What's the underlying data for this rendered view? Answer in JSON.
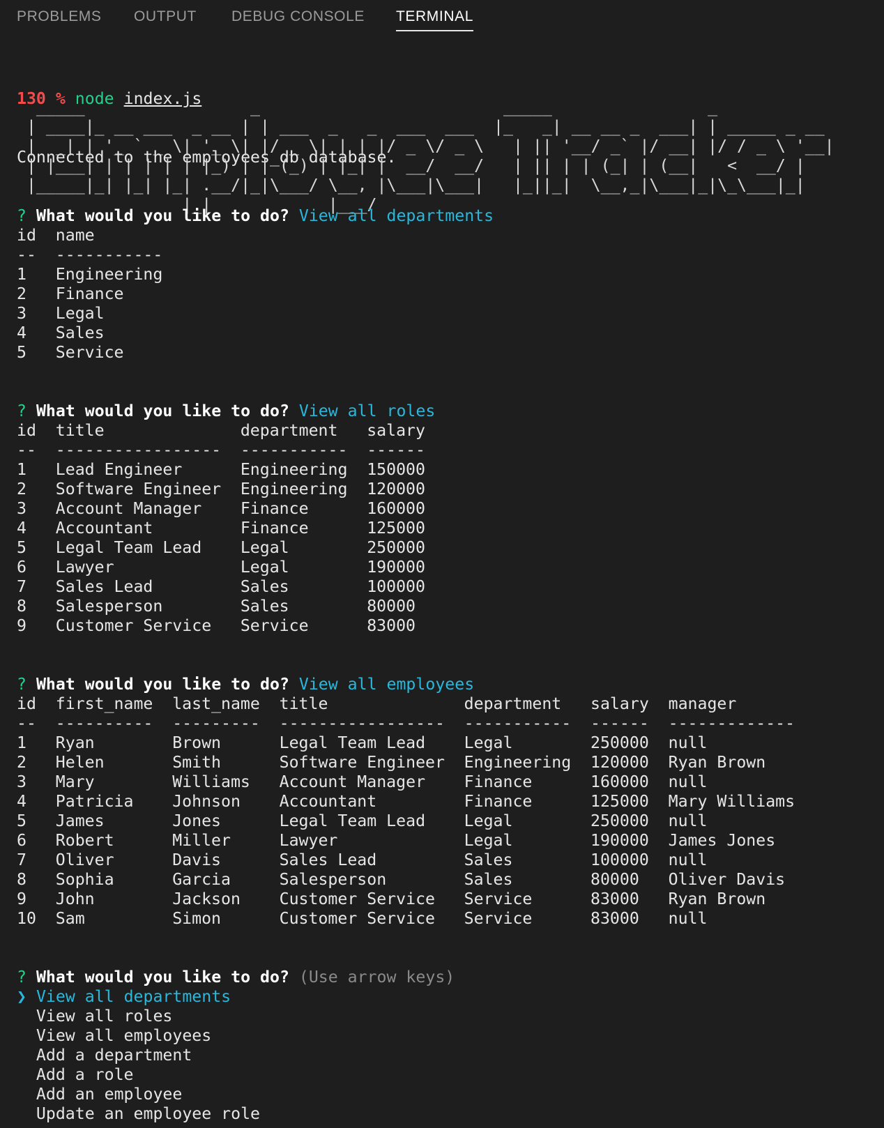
{
  "tabs": [
    {
      "label": "PROBLEMS"
    },
    {
      "label": "OUTPUT"
    },
    {
      "label": "DEBUG CONSOLE"
    },
    {
      "label": "TERMINAL"
    }
  ],
  "command": {
    "exit_code": "130",
    "prompt": "%",
    "cmd": "node",
    "arg": "index.js"
  },
  "connected_text": "Connected to the employees_db database.",
  "ascii_art": [
    "  _____                 _                         _____                _              ",
    " | ____|_ __ ___  _ __ | | ___  _   _  ___  ___  |_   _| __ __ _  ___| | _____ _ __ ",
    " |  _| | '_ ` _ \\| '_ \\| |/ _ \\| | | |/ _ \\/ _ \\   | || '__/ _` |/ __| |/ / _ \\ '__|",
    " | |___| | | | | | |_) | | (_) | |_| |  __/  __/   | || | | (_| | (__|   <  __/ |   ",
    " |_____|_| |_| |_| .__/|_|\\___/ \\__, |\\___|\\___|   |_||_|  \\__,_|\\___|_|\\_\\___|_|   ",
    "                 |_|            |___/                                               "
  ],
  "prompts": {
    "question_mark": "?",
    "question": "What would you like to do?",
    "answer_departments": "View all departments",
    "answer_roles": "View all roles",
    "answer_employees": "View all employees",
    "hint": "(Use arrow keys)"
  },
  "departments_table": {
    "headers": [
      "id",
      "name"
    ],
    "separators": [
      "--",
      "-----------"
    ],
    "rows": [
      [
        "1",
        "Engineering"
      ],
      [
        "2",
        "Finance"
      ],
      [
        "3",
        "Legal"
      ],
      [
        "4",
        "Sales"
      ],
      [
        "5",
        "Service"
      ]
    ]
  },
  "roles_table": {
    "headers": [
      "id",
      "title",
      "department",
      "salary"
    ],
    "separators": [
      "--",
      "-----------------",
      "-----------",
      "------"
    ],
    "rows": [
      [
        "1",
        "Lead Engineer",
        "Engineering",
        "150000"
      ],
      [
        "2",
        "Software Engineer",
        "Engineering",
        "120000"
      ],
      [
        "3",
        "Account Manager",
        "Finance",
        "160000"
      ],
      [
        "4",
        "Accountant",
        "Finance",
        "125000"
      ],
      [
        "5",
        "Legal Team Lead",
        "Legal",
        "250000"
      ],
      [
        "6",
        "Lawyer",
        "Legal",
        "190000"
      ],
      [
        "7",
        "Sales Lead",
        "Sales",
        "100000"
      ],
      [
        "8",
        "Salesperson",
        "Sales",
        "80000"
      ],
      [
        "9",
        "Customer Service",
        "Service",
        "83000"
      ]
    ]
  },
  "employees_table": {
    "headers": [
      "id",
      "first_name",
      "last_name",
      "title",
      "department",
      "salary",
      "manager"
    ],
    "separators": [
      "--",
      "----------",
      "---------",
      "-----------------",
      "-----------",
      "------",
      "-------------"
    ],
    "rows": [
      [
        "1",
        "Ryan",
        "Brown",
        "Legal Team Lead",
        "Legal",
        "250000",
        "null"
      ],
      [
        "2",
        "Helen",
        "Smith",
        "Software Engineer",
        "Engineering",
        "120000",
        "Ryan Brown"
      ],
      [
        "3",
        "Mary",
        "Williams",
        "Account Manager",
        "Finance",
        "160000",
        "null"
      ],
      [
        "4",
        "Patricia",
        "Johnson",
        "Accountant",
        "Finance",
        "125000",
        "Mary Williams"
      ],
      [
        "5",
        "James",
        "Jones",
        "Legal Team Lead",
        "Legal",
        "250000",
        "null"
      ],
      [
        "6",
        "Robert",
        "Miller",
        "Lawyer",
        "Legal",
        "190000",
        "James Jones"
      ],
      [
        "7",
        "Oliver",
        "Davis",
        "Sales Lead",
        "Sales",
        "100000",
        "null"
      ],
      [
        "8",
        "Sophia",
        "Garcia",
        "Salesperson",
        "Sales",
        "80000",
        "Oliver Davis"
      ],
      [
        "9",
        "John",
        "Jackson",
        "Customer Service",
        "Service",
        "83000",
        "Ryan Brown"
      ],
      [
        "10",
        "Sam",
        "Simon",
        "Customer Service",
        "Service",
        "83000",
        "null"
      ]
    ]
  },
  "menu": {
    "pointer": "❯",
    "items": [
      "View all departments",
      "View all roles",
      "View all employees",
      "Add a department",
      "Add a role",
      "Add an employee",
      "Update an employee role"
    ]
  },
  "colors": {
    "background": "#1e1e1e",
    "prompt_red": "#f14c4c",
    "prompt_green": "#23d18b",
    "answer_cyan": "#29b8db"
  }
}
